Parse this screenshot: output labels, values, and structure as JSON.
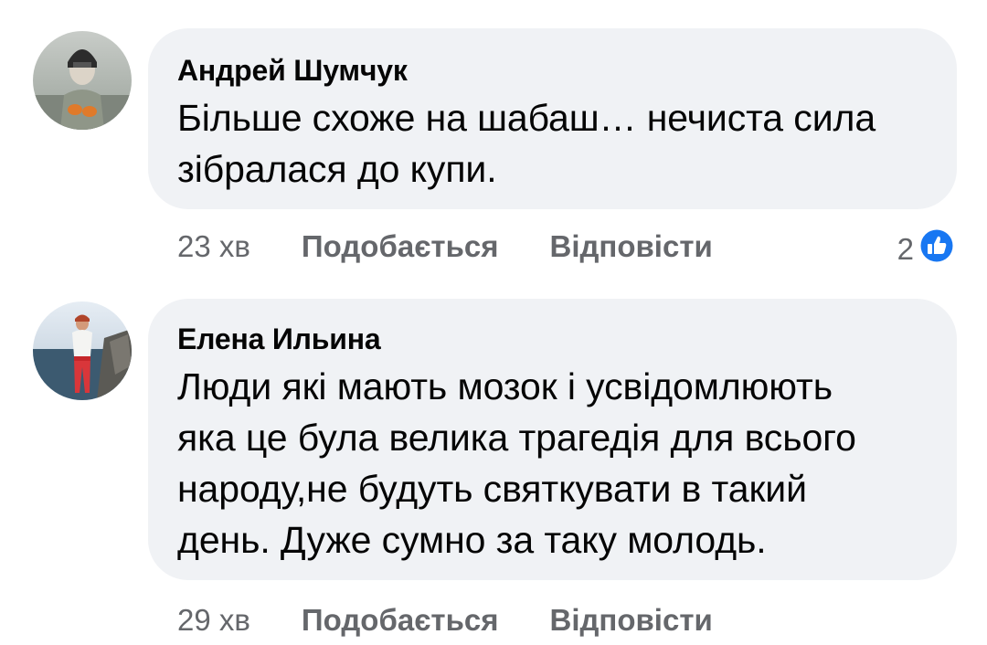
{
  "comments": [
    {
      "author": "Андрей Шумчук",
      "text_lines": [
        "Більше схоже на шабаш… нечиста сила",
        "зібралася до купи."
      ],
      "time": "23 хв",
      "like_label": "Подобається",
      "reply_label": "Відповісти",
      "reaction_count": "2",
      "reaction_icon": "like-icon"
    },
    {
      "author": "Елена Ильина",
      "text_lines": [
        "Люди які мають мозок і усвідомлюють",
        "яка це була велика трагедія для всього",
        "народу,не будуть святкувати в такий",
        "день. Дуже сумно за таку молодь."
      ],
      "time": "29 хв",
      "like_label": "Подобається",
      "reply_label": "Відповісти"
    }
  ],
  "colors": {
    "bubble": "#f0f2f5",
    "text": "#050505",
    "meta": "#65676b",
    "like_blue": "#1877f2"
  }
}
